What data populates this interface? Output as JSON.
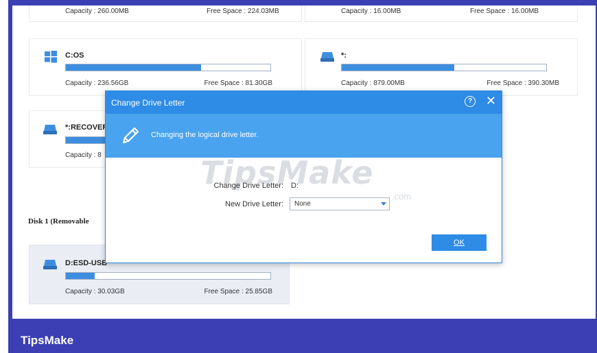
{
  "top_row": {
    "left": {
      "capacity": "Capacity : 260.00MB",
      "free": "Free Space : 224.03MB"
    },
    "right": {
      "capacity": "Capacity : 16.00MB",
      "free": "Free Space : 16.00MB"
    }
  },
  "partitions": [
    {
      "name": "C:OS",
      "icon": "windows-icon",
      "usage": 0.66,
      "capacity": "Capacity : 236.56GB",
      "free": "Free Space : 81.30GB"
    },
    {
      "name": "*:",
      "icon": "drive-icon",
      "usage": 0.55,
      "capacity": "Capacity : 879.00MB",
      "free": "Free Space : 390.30MB"
    },
    {
      "name": "*:RECOVER",
      "icon": "drive-icon",
      "usage": 0.25,
      "capacity": "Capacity : 8",
      "free": ""
    }
  ],
  "disk1": {
    "title": "Disk 1 (Removable",
    "partition": {
      "name": "D:ESD-USB",
      "icon": "drive-icon",
      "usage": 0.14,
      "capacity": "Capacity : 30.03GB",
      "free": "Free Space : 25.85GB"
    }
  },
  "dialog": {
    "title": "Change Drive Letter",
    "help_glyph": "?",
    "close_glyph": "✕",
    "banner_text": "Changing the logical drive letter.",
    "change_label": "Change Drive Letter:",
    "change_value": "D:",
    "new_label": "New Drive Letter:",
    "new_value": "None",
    "ok_label": "OK"
  },
  "watermark": {
    "text": "TipsMake",
    "sub": ".com"
  },
  "footer": {
    "brand": "TipsMake"
  },
  "colors": {
    "accent": "#2e8be6",
    "banner": "#4aa3ee",
    "bar_fill": "#3e8ee0",
    "frame": "#3b3fb3"
  }
}
